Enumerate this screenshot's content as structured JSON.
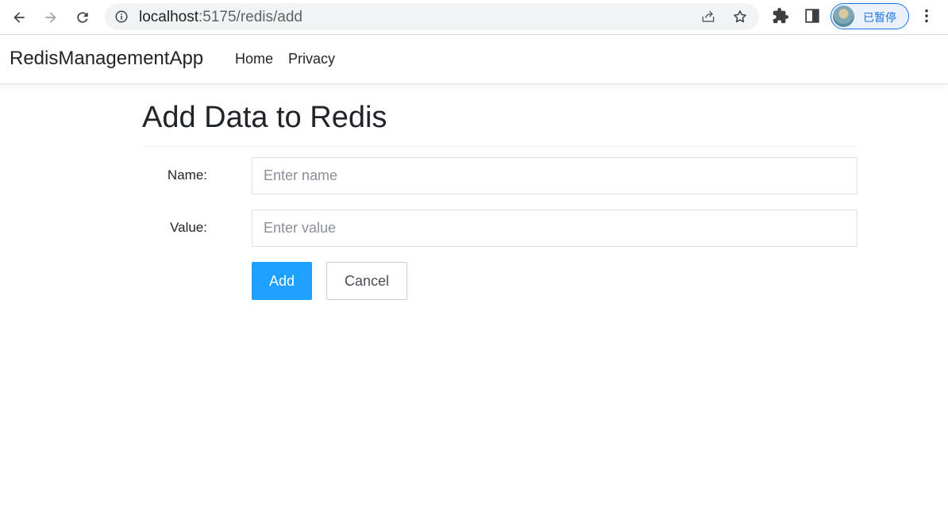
{
  "browser": {
    "url_host": "localhost",
    "url_rest": ":5175/redis/add",
    "profile_status": "已暂停"
  },
  "navbar": {
    "brand": "RedisManagementApp",
    "links": [
      "Home",
      "Privacy"
    ]
  },
  "page": {
    "title": "Add Data to Redis"
  },
  "form": {
    "name_label": "Name:",
    "name_placeholder": "Enter name",
    "name_value": "",
    "value_label": "Value:",
    "value_placeholder": "Enter value",
    "value_value": "",
    "add_button": "Add",
    "cancel_button": "Cancel"
  },
  "colors": {
    "primary_button": "#1ea0ff",
    "profile_accent": "#1a73e8"
  },
  "icons": [
    "back-icon",
    "forward-icon",
    "reload-icon",
    "info-icon",
    "share-icon",
    "star-icon",
    "extensions-icon",
    "side-panel-icon",
    "kebab-menu-icon"
  ]
}
